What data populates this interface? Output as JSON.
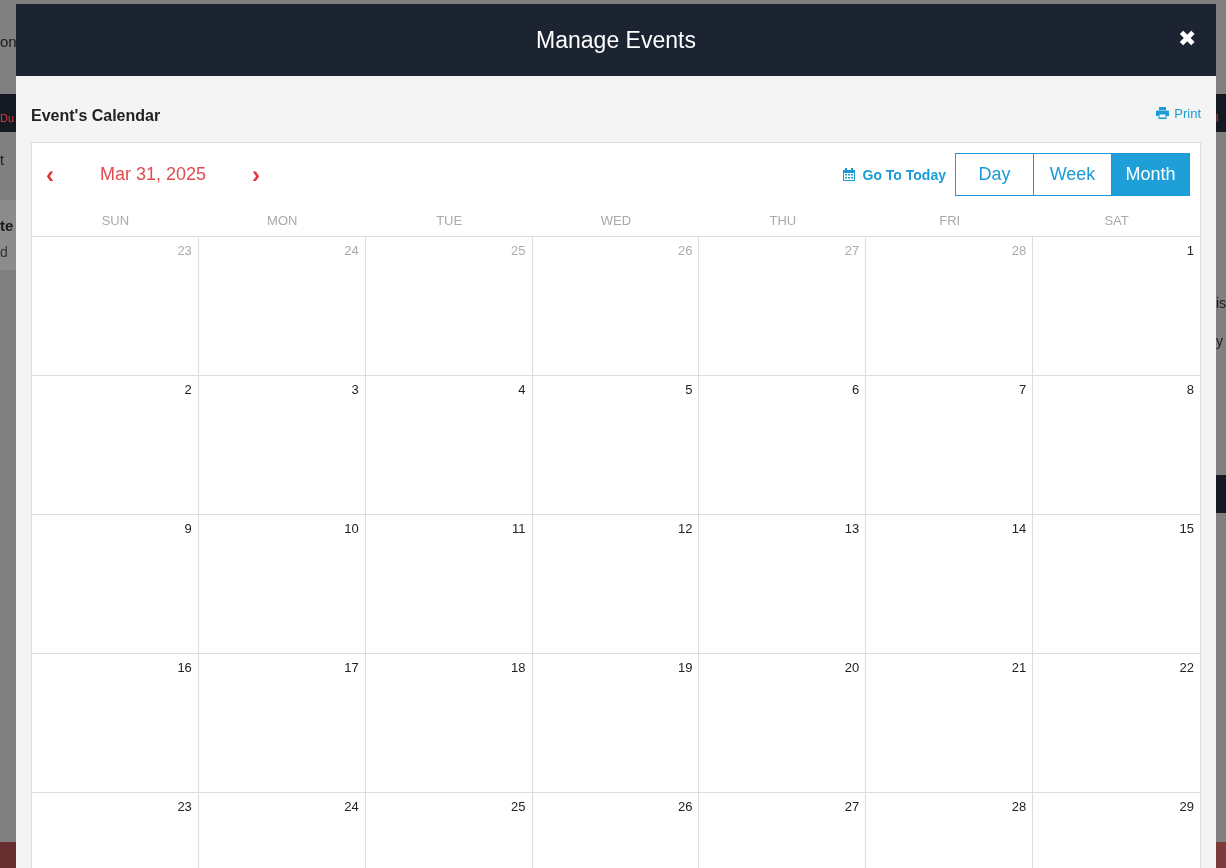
{
  "backdrop": {
    "left": [
      {
        "kind": "title",
        "text": "on"
      },
      {
        "kind": "nav",
        "text": "Du"
      },
      {
        "kind": "plain",
        "text": "t"
      },
      {
        "kind": "bold",
        "text": "te"
      },
      {
        "kind": "sub",
        "text": "d"
      }
    ],
    "right": [
      {
        "kind": "nav",
        "text": "l"
      },
      {
        "kind": "plain",
        "text": "is"
      },
      {
        "kind": "plain",
        "text": "y"
      }
    ]
  },
  "modal": {
    "title": "Manage Events",
    "close": "✖",
    "section_title": "Event's Calendar",
    "print": "Print",
    "calendar": {
      "prev": "‹",
      "date": "Mar 31, 2025",
      "next": "›",
      "go_to_today": "Go To Today",
      "views": [
        {
          "label": "Day",
          "selected": false
        },
        {
          "label": "Week",
          "selected": false
        },
        {
          "label": "Month",
          "selected": true
        }
      ],
      "weekdays": [
        "SUN",
        "MON",
        "TUE",
        "WED",
        "THU",
        "FRI",
        "SAT"
      ],
      "weeks": [
        [
          {
            "day": "23",
            "muted": true
          },
          {
            "day": "24",
            "muted": true
          },
          {
            "day": "25",
            "muted": true
          },
          {
            "day": "26",
            "muted": true
          },
          {
            "day": "27",
            "muted": true
          },
          {
            "day": "28",
            "muted": true
          },
          {
            "day": "1",
            "muted": false
          }
        ],
        [
          {
            "day": "2",
            "muted": false
          },
          {
            "day": "3",
            "muted": false
          },
          {
            "day": "4",
            "muted": false
          },
          {
            "day": "5",
            "muted": false
          },
          {
            "day": "6",
            "muted": false
          },
          {
            "day": "7",
            "muted": false
          },
          {
            "day": "8",
            "muted": false
          }
        ],
        [
          {
            "day": "9",
            "muted": false
          },
          {
            "day": "10",
            "muted": false
          },
          {
            "day": "11",
            "muted": false
          },
          {
            "day": "12",
            "muted": false
          },
          {
            "day": "13",
            "muted": false
          },
          {
            "day": "14",
            "muted": false
          },
          {
            "day": "15",
            "muted": false
          }
        ],
        [
          {
            "day": "16",
            "muted": false
          },
          {
            "day": "17",
            "muted": false
          },
          {
            "day": "18",
            "muted": false
          },
          {
            "day": "19",
            "muted": false
          },
          {
            "day": "20",
            "muted": false
          },
          {
            "day": "21",
            "muted": false
          },
          {
            "day": "22",
            "muted": false
          }
        ],
        [
          {
            "day": "23",
            "muted": false
          },
          {
            "day": "24",
            "muted": false
          },
          {
            "day": "25",
            "muted": false
          },
          {
            "day": "26",
            "muted": false
          },
          {
            "day": "27",
            "muted": false
          },
          {
            "day": "28",
            "muted": false
          },
          {
            "day": "29",
            "muted": false
          }
        ]
      ]
    }
  }
}
